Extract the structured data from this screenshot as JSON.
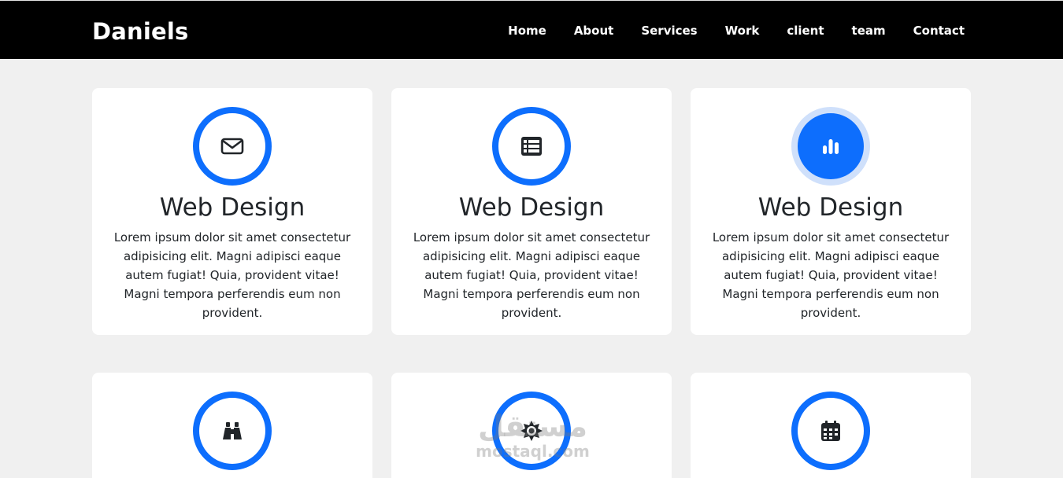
{
  "navbar": {
    "brand": "Daniels",
    "links": [
      "Home",
      "About",
      "Services",
      "Work",
      "client",
      "team",
      "Contact"
    ]
  },
  "cards": [
    {
      "icon": "envelope-icon",
      "title": "Web Design",
      "text": "Lorem ipsum dolor sit amet consectetur adipisicing elit. Magni adipisci eaque autem fugiat! Quia, provident vitae! Magni tempora perferendis eum non provident."
    },
    {
      "icon": "table-list-icon",
      "title": "Web Design",
      "text": "Lorem ipsum dolor sit amet consectetur adipisicing elit. Magni adipisci eaque autem fugiat! Quia, provident vitae! Magni tempora perferendis eum non provident."
    },
    {
      "icon": "bar-chart-icon",
      "title": "Web Design",
      "text": "Lorem ipsum dolor sit amet consectetur adipisicing elit. Magni adipisci eaque autem fugiat! Quia, provident vitae! Magni tempora perferendis eum non provident."
    },
    {
      "icon": "binoculars-icon"
    },
    {
      "icon": "camera-shutter-icon"
    },
    {
      "icon": "calendar-icon"
    }
  ],
  "watermark": {
    "arabic": "مستقل",
    "latin": "mostaql.com"
  },
  "colors": {
    "accent": "#0d6efd",
    "accent_light": "#cfe0fb",
    "navbar": "#000000",
    "background": "#f0f0f0"
  }
}
